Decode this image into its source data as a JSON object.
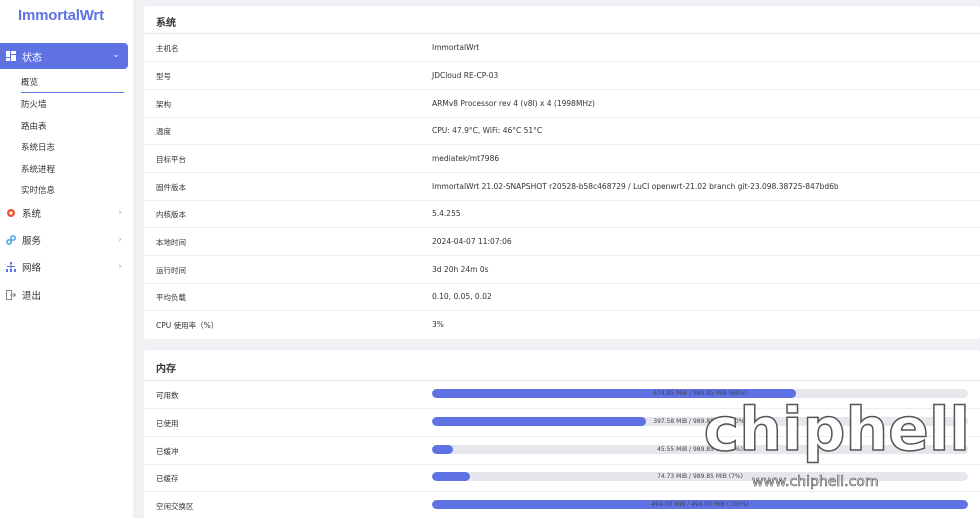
{
  "sidebar": {
    "logo": "ImmortalWrt",
    "active_menu": "状态",
    "sub_items": [
      "概览",
      "防火墙",
      "路由表",
      "系统日志",
      "系统进程",
      "实时信息"
    ],
    "menus": [
      {
        "label": "系统",
        "icon": "gear-icon"
      },
      {
        "label": "服务",
        "icon": "link-icon"
      },
      {
        "label": "网络",
        "icon": "network-icon"
      },
      {
        "label": "退出",
        "icon": "logout-icon"
      }
    ]
  },
  "system": {
    "title": "系统",
    "rows": [
      {
        "k": "主机名",
        "v": "ImmortalWrt"
      },
      {
        "k": "型号",
        "v": "JDCloud RE-CP-03"
      },
      {
        "k": "架构",
        "v": "ARMv8 Processor rev 4 (v8l) x 4 (1998MHz)"
      },
      {
        "k": "温度",
        "v": "CPU: 47.9°C, WiFi: 46°C 51°C"
      },
      {
        "k": "目标平台",
        "v": "mediatek/mt7986"
      },
      {
        "k": "固件版本",
        "v": "ImmortalWrt 21.02-SNAPSHOT r20528-b58c468729 / LuCI openwrt-21.02 branch git-23.098.38725-847bd6b"
      },
      {
        "k": "内核版本",
        "v": "5.4.255"
      },
      {
        "k": "本地时间",
        "v": "2024-04-07 11:07:06"
      },
      {
        "k": "运行时间",
        "v": "3d 20h 24m 0s"
      },
      {
        "k": "平均负载",
        "v": "0.10, 0.05, 0.02"
      },
      {
        "k": "CPU 使用率（%）",
        "v": "3%"
      }
    ]
  },
  "memory": {
    "title": "内存",
    "rows": [
      {
        "k": "可用数",
        "text": "674.85 MiB / 989.85 MiB (68%)",
        "pct": 68
      },
      {
        "k": "已使用",
        "text": "397.58 MiB / 989.85 MiB (40%)",
        "pct": 40
      },
      {
        "k": "已缓冲",
        "text": "45.55 MiB / 989.85 MiB (4%)",
        "pct": 4
      },
      {
        "k": "已缓存",
        "text": "74.73 MiB / 989.85 MiB (7%)",
        "pct": 7
      },
      {
        "k": "空闲交换区",
        "text": "494.00 MiB / 494.00 MiB (100%)",
        "pct": 100
      }
    ]
  },
  "watermark": {
    "logo": "chiphell",
    "url": "www.chiphell.com"
  },
  "colors": {
    "accent": "#5e72e4",
    "track": "#e6e7ec"
  }
}
